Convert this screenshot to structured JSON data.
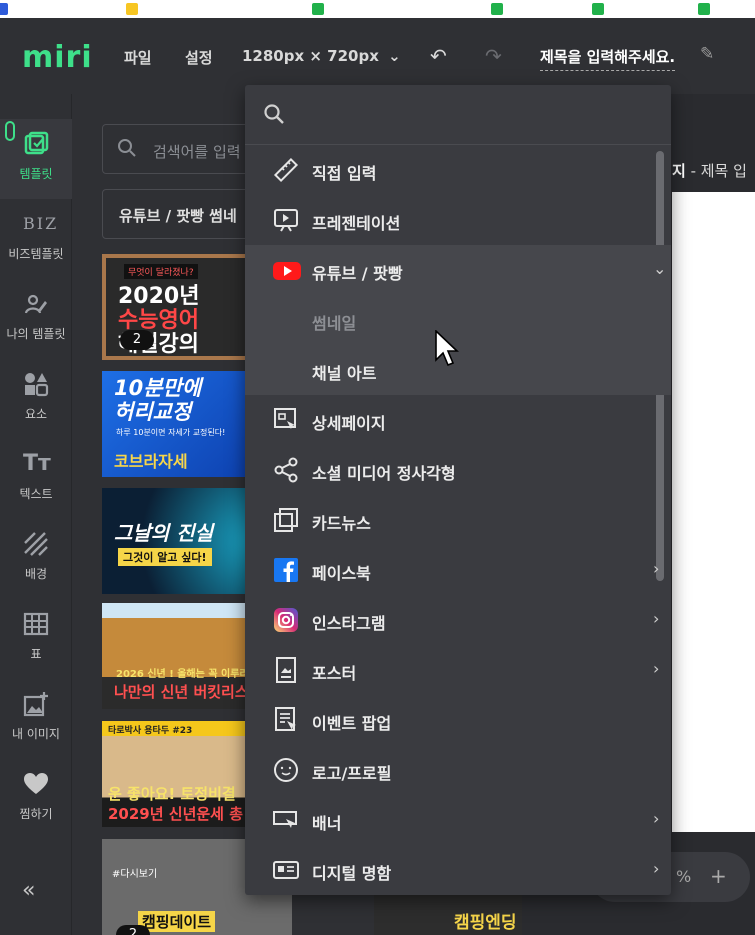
{
  "app": {
    "logo": "miri",
    "menu_file": "파일",
    "menu_settings": "설정",
    "size_label": "1280px × 720px",
    "doc_title": "제목을 입력해주세요."
  },
  "sidebar": {
    "items": [
      {
        "label": "템플릿",
        "icon": "template-icon"
      },
      {
        "label": "비즈템플릿",
        "icon": "biz-icon",
        "glyph": "BIZ"
      },
      {
        "label": "나의 템플릿",
        "icon": "my-template-icon"
      },
      {
        "label": "요소",
        "icon": "elements-icon"
      },
      {
        "label": "텍스트",
        "icon": "text-icon"
      },
      {
        "label": "배경",
        "icon": "background-icon"
      },
      {
        "label": "표",
        "icon": "table-icon"
      },
      {
        "label": "내 이미지",
        "icon": "my-image-icon"
      },
      {
        "label": "찜하기",
        "icon": "heart-icon"
      }
    ],
    "collapse": "«"
  },
  "panel": {
    "search_placeholder": "검색어를 입력",
    "category": "유튜브 / 팟빵 썸네",
    "thumbnails": [
      {
        "text1": "2020년",
        "text2": "수능영어",
        "text3": "해설강의",
        "tag": "무엇이 달라졌나?",
        "badge": "2"
      },
      {
        "text1": "10분만에",
        "text2": "허리교정",
        "text3": "코브라자세",
        "tag": "하루 10분이면 자세가 교정된다!"
      },
      {
        "text1": "그날의 진실",
        "text2": "그것이 알고 싶다!"
      },
      {
        "text1": "2026 신년 ! 올해는 꼭 이루리라!",
        "text2": "나만의 신년 버킷리스트"
      },
      {
        "tag": "타로박사 용타두 #23",
        "text1": "운 좋아요! 토정비결",
        "text2": "2029년 신년운세 총"
      },
      {
        "text1": "#다시보기",
        "text2": "캠핑데이트",
        "badge": "2"
      },
      {
        "text1": "캠핑엔딩"
      }
    ]
  },
  "canvas": {
    "header_bold": "지",
    "header_rest": " - 제목 입",
    "zoom_pct": "%",
    "zoom_plus": "+"
  },
  "dropdown": {
    "items": [
      {
        "label": "직접 입력",
        "icon": "ruler-icon",
        "chevron": false
      },
      {
        "label": "프레젠테이션",
        "icon": "presentation-icon",
        "chevron": false
      },
      {
        "label": "유튜브 / 팟빵",
        "icon": "youtube-icon",
        "chevron": true,
        "expanded": true
      },
      {
        "label": "썸네일",
        "sub": true,
        "dim": true
      },
      {
        "label": "채널 아트",
        "sub": true
      },
      {
        "label": "상세페이지",
        "icon": "detail-page-icon",
        "chevron": false
      },
      {
        "label": "소셜 미디어 정사각형",
        "icon": "share-icon",
        "chevron": false
      },
      {
        "label": "카드뉴스",
        "icon": "cardnews-icon",
        "chevron": false
      },
      {
        "label": "페이스북",
        "icon": "facebook-icon",
        "chevron": true
      },
      {
        "label": "인스타그램",
        "icon": "instagram-icon",
        "chevron": true
      },
      {
        "label": "포스터",
        "icon": "poster-icon",
        "chevron": true
      },
      {
        "label": "이벤트 팝업",
        "icon": "event-popup-icon",
        "chevron": false
      },
      {
        "label": "로고/프로필",
        "icon": "logo-profile-icon",
        "chevron": false
      },
      {
        "label": "배너",
        "icon": "banner-icon",
        "chevron": true
      },
      {
        "label": "디지털 명함",
        "icon": "business-card-icon",
        "chevron": true
      }
    ]
  },
  "colors": {
    "brand": "#3ee08a",
    "bg": "#2f3034",
    "dropdown_bg": "#3a3b40"
  }
}
